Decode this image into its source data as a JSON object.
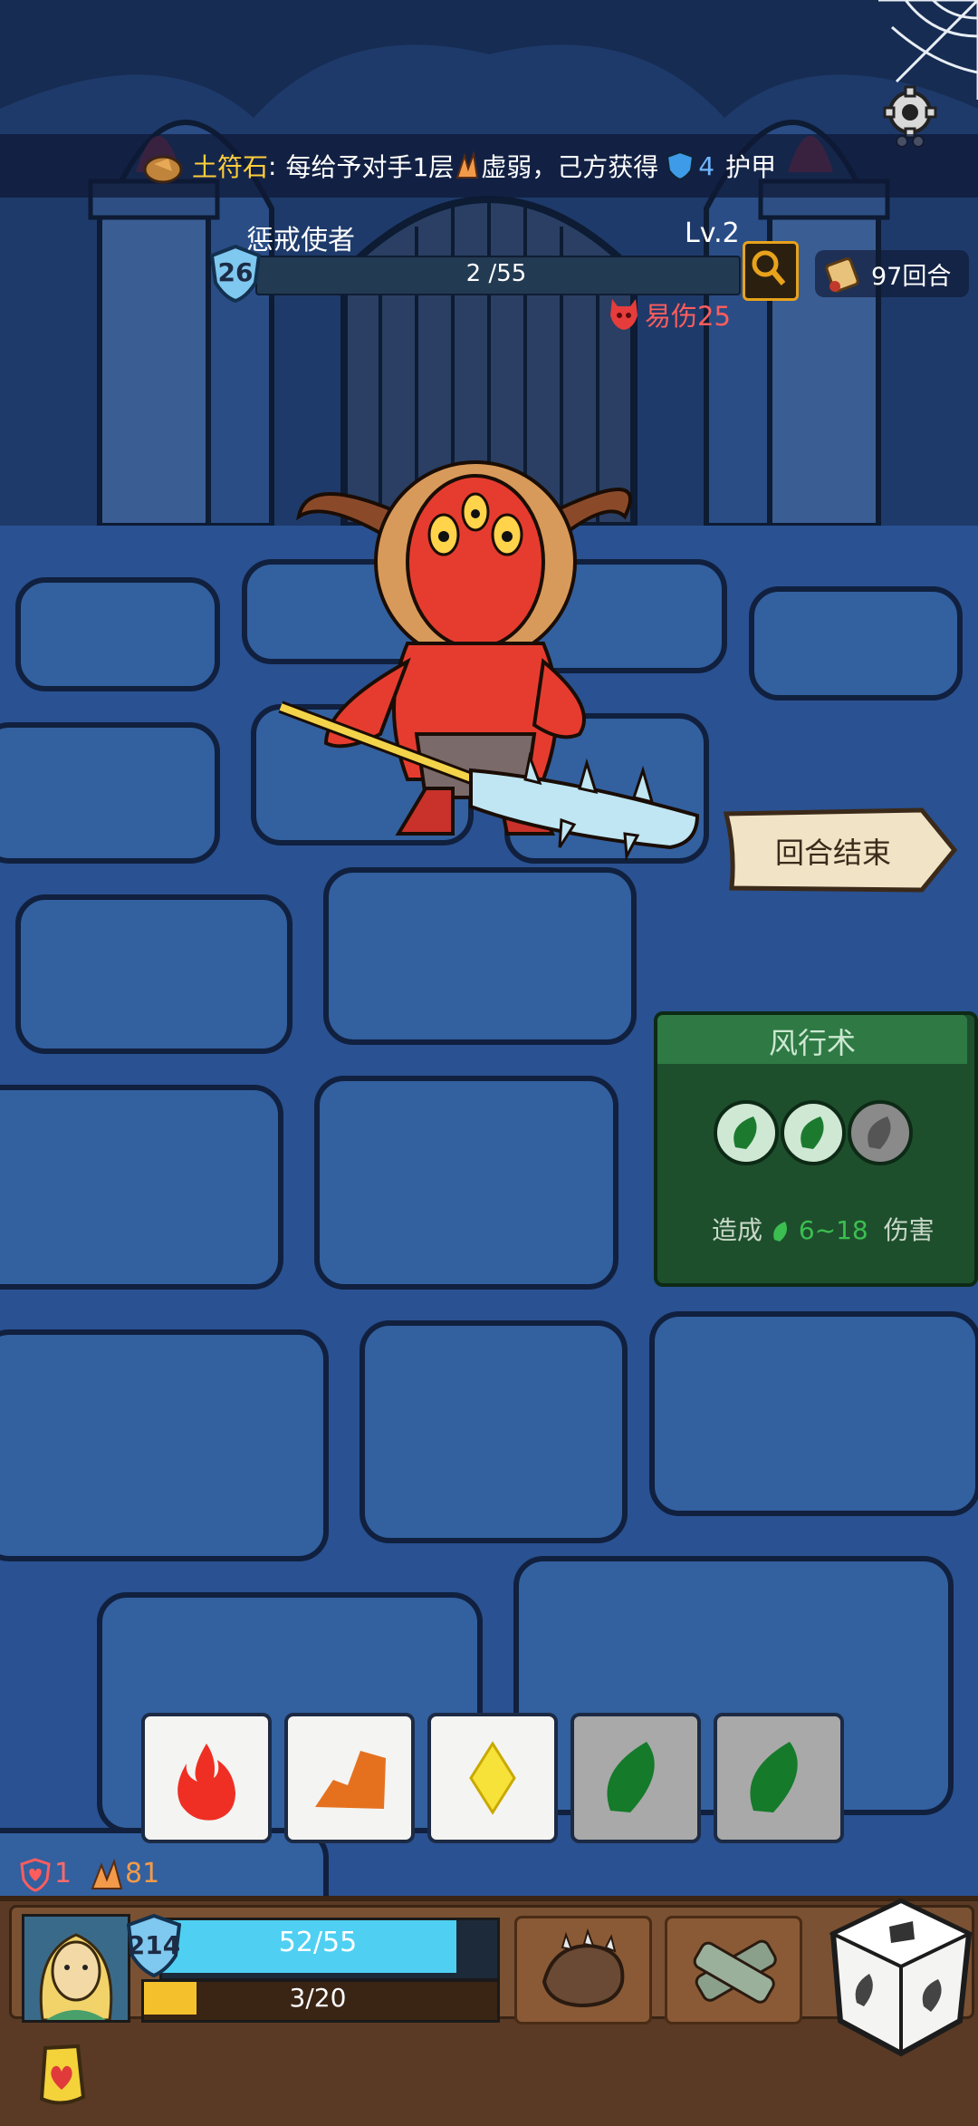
{
  "banner": {
    "prefix_name": "土符石",
    "prefix_colon": ":",
    "text_part1": "每给予对手1层",
    "text_part2": "虚弱，己方获得",
    "shield_value": "4",
    "text_part3": "护甲"
  },
  "enemy": {
    "name": "惩戒使者",
    "level": "Lv.2",
    "shield": "26",
    "hp_current": 2,
    "hp_max": 55,
    "hp_text": "2 /55",
    "status_text": "易伤25"
  },
  "rounds": {
    "text": "97回合"
  },
  "end_turn": {
    "label": "回合结束"
  },
  "skill": {
    "title": "风行术",
    "slots_filled": 2,
    "slots_total": 3,
    "desc_prefix": "造成",
    "damage_range": "6~18",
    "desc_suffix": "伤害"
  },
  "dice": [
    {
      "type": "fire-icon",
      "state": "available"
    },
    {
      "type": "earth-icon",
      "state": "available"
    },
    {
      "type": "lightning-icon",
      "state": "available"
    },
    {
      "type": "wind-icon",
      "state": "used"
    },
    {
      "type": "wind-icon",
      "state": "used"
    }
  ],
  "player_stats": {
    "heart_count": "1",
    "fire_count": "81"
  },
  "player": {
    "shield": "214",
    "hp_current": 52,
    "hp_max": 55,
    "hp_text": "52/55",
    "exp_current": 3,
    "exp_max": 20,
    "exp_text": "3/20"
  },
  "colors": {
    "background": "#23467f",
    "skill_green": "#2f7a44",
    "hp_blue": "#4fd0f2",
    "exp_yellow": "#f4c12d",
    "vulnerable_red": "#ff5d5d"
  }
}
